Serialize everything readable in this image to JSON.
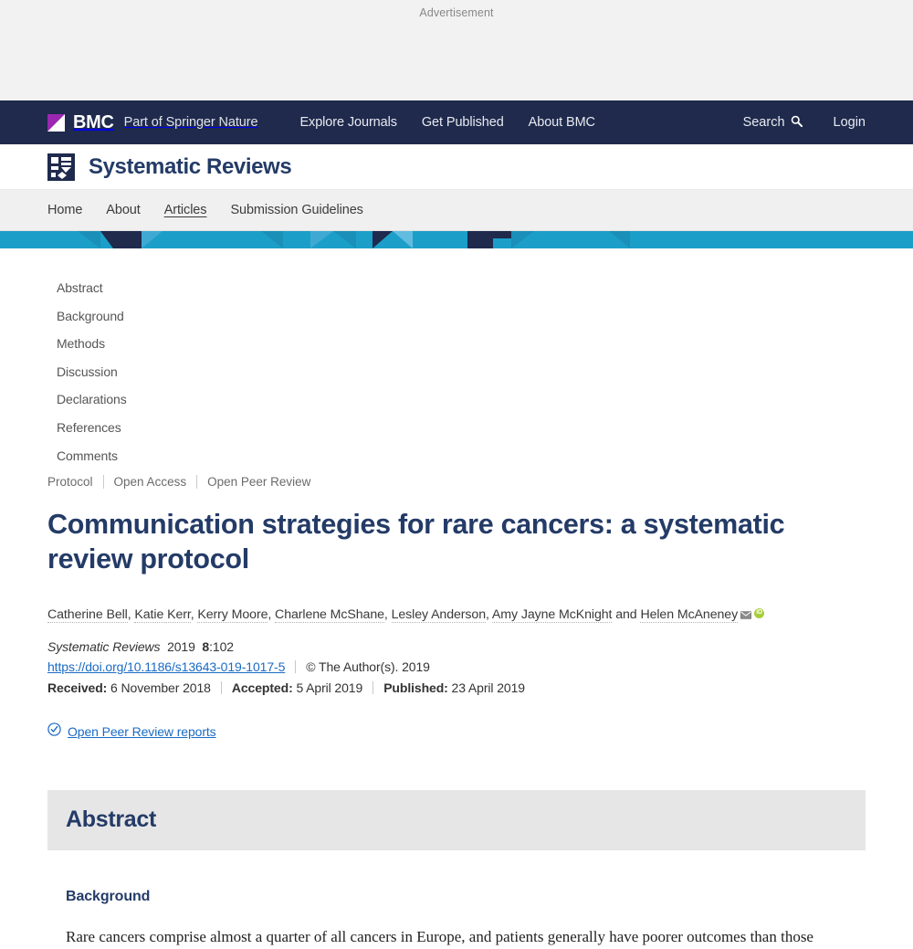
{
  "ad": {
    "label": "Advertisement"
  },
  "topbar": {
    "brand_word": "BMC",
    "brand_tagline": "Part of Springer Nature",
    "nav": [
      {
        "label": "Explore Journals"
      },
      {
        "label": "Get Published"
      },
      {
        "label": "About BMC"
      }
    ],
    "search_label": "Search",
    "login_label": "Login"
  },
  "journal": {
    "name": "Systematic Reviews",
    "nav": [
      {
        "label": "Home",
        "active": false
      },
      {
        "label": "About",
        "active": false
      },
      {
        "label": "Articles",
        "active": true
      },
      {
        "label": "Submission Guidelines",
        "active": false
      }
    ]
  },
  "toc": {
    "items": [
      {
        "label": "Abstract"
      },
      {
        "label": "Background"
      },
      {
        "label": "Methods"
      },
      {
        "label": "Discussion"
      },
      {
        "label": "Declarations"
      },
      {
        "label": "References"
      },
      {
        "label": "Comments"
      }
    ]
  },
  "article": {
    "badges": [
      "Protocol",
      "Open Access",
      "Open Peer Review"
    ],
    "title": "Communication strategies for rare cancers: a systematic review protocol",
    "authors": [
      "Catherine Bell",
      "Katie Kerr",
      "Kerry Moore",
      "Charlene McShane",
      "Lesley Anderson",
      "Amy Jayne McKnight"
    ],
    "authors_conjunction": "and",
    "corresponding_author": "Helen McAneney",
    "journal_italic": "Systematic Reviews",
    "year": "2019",
    "volume": "8",
    "article_number": ":102",
    "doi_text": "https://doi.org/10.1186/s13643-019-1017-5",
    "copyright": "©  The Author(s). 2019",
    "received_label": "Received:",
    "received_value": "6 November 2018",
    "accepted_label": "Accepted:",
    "accepted_value": "5 April 2019",
    "published_label": "Published:",
    "published_value": "23 April 2019",
    "peer_review_link": "Open Peer Review reports"
  },
  "abstract": {
    "heading": "Abstract",
    "background_heading": "Background",
    "background_text": "Rare cancers comprise almost a quarter of all cancers in Europe, and patients generally have poorer outcomes than those"
  },
  "colors": {
    "bmc_navy": "#1f2a4d",
    "journal_heading": "#243b67",
    "banner_teal": "#1b9fc9",
    "link_blue": "#1a6bc4",
    "orcid_green": "#a6ce39",
    "bmc_purple": "#9b27b0"
  }
}
